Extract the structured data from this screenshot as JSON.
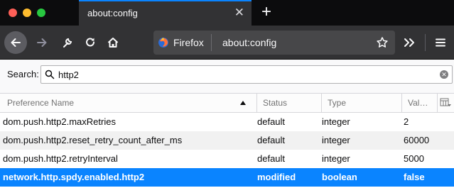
{
  "tab": {
    "title": "about:config"
  },
  "urlbar": {
    "identity_label": "Firefox",
    "url": "about:config"
  },
  "search": {
    "label": "Search:",
    "value": "http2"
  },
  "table": {
    "columns": {
      "name": "Preference Name",
      "status": "Status",
      "type": "Type",
      "value": "Val…"
    },
    "rows": [
      {
        "name": "dom.push.http2.maxRetries",
        "status": "default",
        "type": "integer",
        "value": "2"
      },
      {
        "name": "dom.push.http2.reset_retry_count_after_ms",
        "status": "default",
        "type": "integer",
        "value": "60000"
      },
      {
        "name": "dom.push.http2.retryInterval",
        "status": "default",
        "type": "integer",
        "value": "5000"
      },
      {
        "name": "network.http.spdy.enabled.http2",
        "status": "modified",
        "type": "boolean",
        "value": "false"
      }
    ]
  },
  "colors": {
    "accent": "#0a84ff",
    "chrome_dark": "#0c0c0d",
    "toolbar": "#323234"
  }
}
